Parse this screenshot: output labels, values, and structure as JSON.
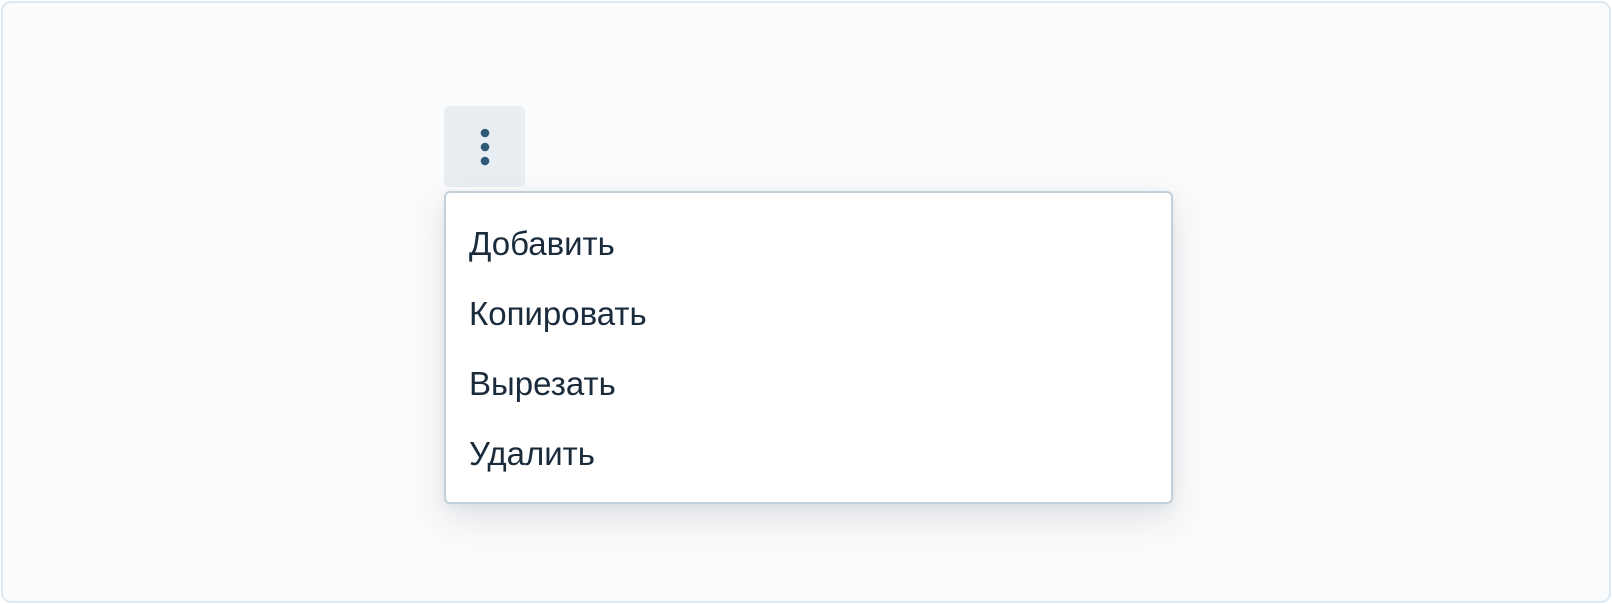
{
  "colors": {
    "text": "#1a2b3c",
    "button_bg": "#e9eef2",
    "icon": "#2e5a78",
    "menu_border": "#c2d0dc"
  },
  "menu_button": {
    "icon": "kebab-vertical-icon"
  },
  "menu": {
    "items": [
      {
        "label": "Добавить"
      },
      {
        "label": "Копировать"
      },
      {
        "label": "Вырезать"
      },
      {
        "label": "Удалить"
      }
    ]
  }
}
